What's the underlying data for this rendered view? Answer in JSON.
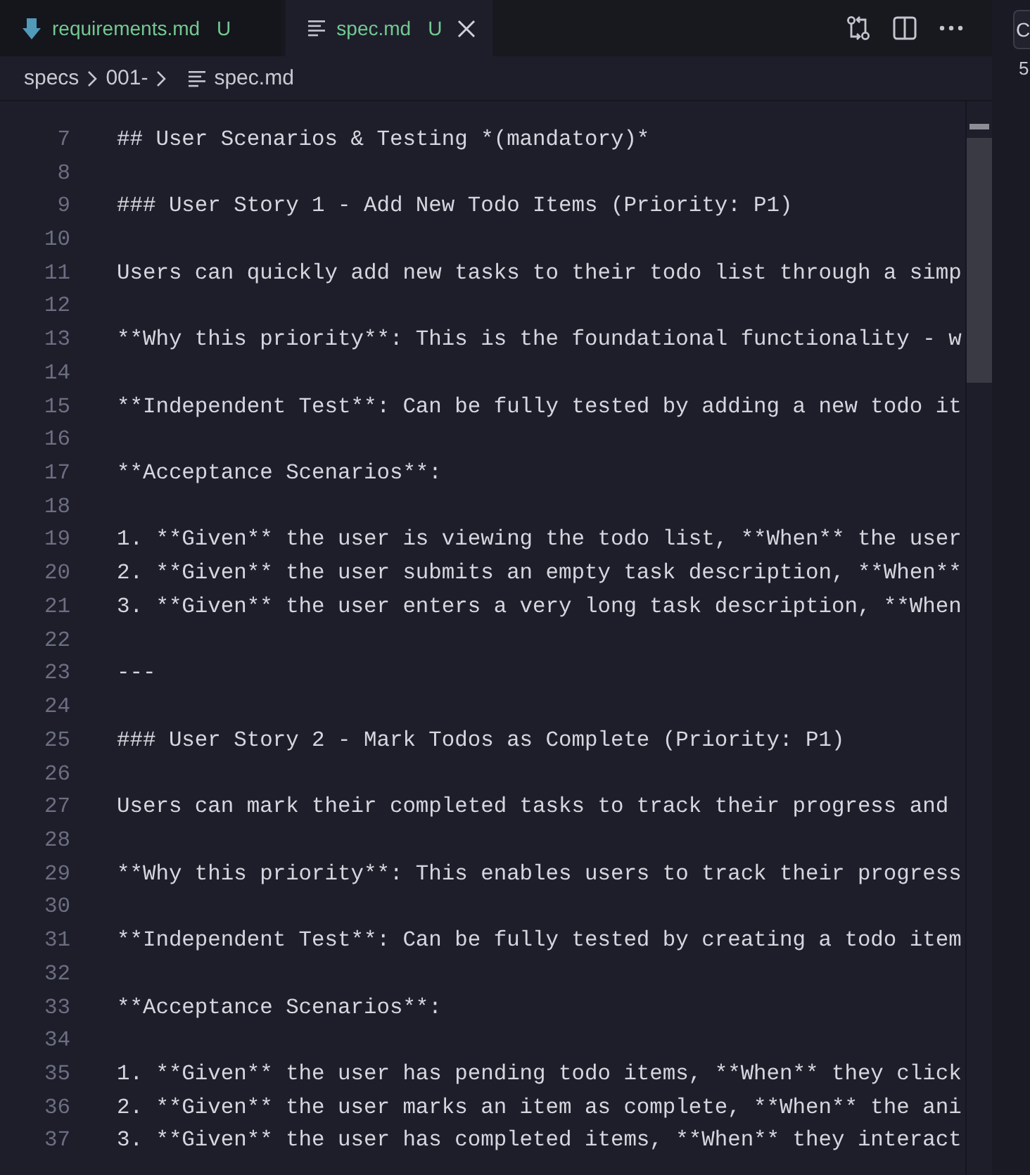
{
  "tabs": [
    {
      "label": "requirements.md",
      "status": "U",
      "kind": "markdown",
      "selected": false
    },
    {
      "label": "spec.md",
      "status": "U",
      "kind": "text",
      "selected": true
    }
  ],
  "breadcrumbs": [
    {
      "label": "specs",
      "kind": "folder"
    },
    {
      "label": "001-",
      "kind": "folder"
    },
    {
      "label": "spec.md",
      "kind": "file"
    }
  ],
  "editor": {
    "lines": [
      {
        "number": "7",
        "text": "## User Scenarios & Testing *(mandatory)*"
      },
      {
        "number": "8"
      },
      {
        "number": "9",
        "text": "### User Story 1 - Add New Todo Items (Priority: P1)"
      },
      {
        "number": "10"
      },
      {
        "number": "11",
        "text": "Users can quickly add new tasks to their todo list through a simp"
      },
      {
        "number": "12"
      },
      {
        "number": "13",
        "text": "**Why this priority**: This is the foundational functionality - w"
      },
      {
        "number": "14"
      },
      {
        "number": "15",
        "text": "**Independent Test**: Can be fully tested by adding a new todo it"
      },
      {
        "number": "16"
      },
      {
        "number": "17",
        "text": "**Acceptance Scenarios**:"
      },
      {
        "number": "18"
      },
      {
        "number": "19",
        "text": "1. **Given** the user is viewing the todo list, **When** the user"
      },
      {
        "number": "20",
        "text": "2. **Given** the user submits an empty task description, **When**"
      },
      {
        "number": "21",
        "text": "3. **Given** the user enters a very long task description, **When"
      },
      {
        "number": "22"
      },
      {
        "number": "23",
        "text": "---"
      },
      {
        "number": "24"
      },
      {
        "number": "25",
        "text": "### User Story 2 - Mark Todos as Complete (Priority: P1)"
      },
      {
        "number": "26"
      },
      {
        "number": "27",
        "text": "Users can mark their completed tasks to track their progress and"
      },
      {
        "number": "28"
      },
      {
        "number": "29",
        "text": "**Why this priority**: This enables users to track their progress"
      },
      {
        "number": "30"
      },
      {
        "number": "31",
        "text": "**Independent Test**: Can be fully tested by creating a todo item"
      },
      {
        "number": "32"
      },
      {
        "number": "33",
        "text": "**Acceptance Scenarios**:"
      },
      {
        "number": "34"
      },
      {
        "number": "35",
        "text": "1. **Given** the user has pending todo items, **When** they click"
      },
      {
        "number": "36",
        "text": "2. **Given** the user marks an item as complete, **When** the ani"
      },
      {
        "number": "37",
        "text": "3. **Given** the user has completed items, **When** they interact"
      }
    ]
  },
  "side_panel": {
    "field_value": "C",
    "text": "5"
  }
}
